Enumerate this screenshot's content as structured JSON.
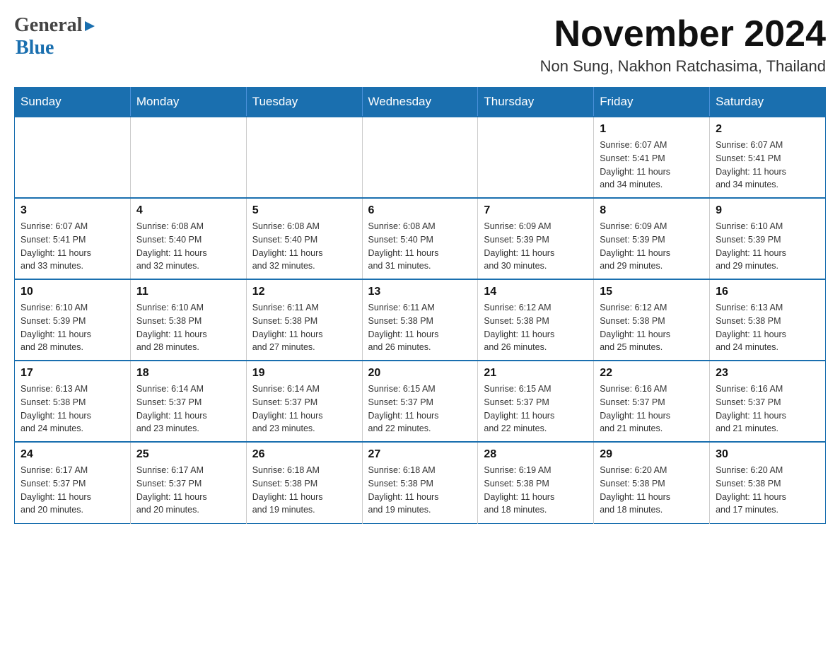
{
  "header": {
    "logo_general": "General",
    "logo_blue": "Blue",
    "month_title": "November 2024",
    "location": "Non Sung, Nakhon Ratchasima, Thailand"
  },
  "days_of_week": [
    "Sunday",
    "Monday",
    "Tuesday",
    "Wednesday",
    "Thursday",
    "Friday",
    "Saturday"
  ],
  "weeks": [
    [
      {
        "day": "",
        "info": ""
      },
      {
        "day": "",
        "info": ""
      },
      {
        "day": "",
        "info": ""
      },
      {
        "day": "",
        "info": ""
      },
      {
        "day": "",
        "info": ""
      },
      {
        "day": "1",
        "info": "Sunrise: 6:07 AM\nSunset: 5:41 PM\nDaylight: 11 hours\nand 34 minutes."
      },
      {
        "day": "2",
        "info": "Sunrise: 6:07 AM\nSunset: 5:41 PM\nDaylight: 11 hours\nand 34 minutes."
      }
    ],
    [
      {
        "day": "3",
        "info": "Sunrise: 6:07 AM\nSunset: 5:41 PM\nDaylight: 11 hours\nand 33 minutes."
      },
      {
        "day": "4",
        "info": "Sunrise: 6:08 AM\nSunset: 5:40 PM\nDaylight: 11 hours\nand 32 minutes."
      },
      {
        "day": "5",
        "info": "Sunrise: 6:08 AM\nSunset: 5:40 PM\nDaylight: 11 hours\nand 32 minutes."
      },
      {
        "day": "6",
        "info": "Sunrise: 6:08 AM\nSunset: 5:40 PM\nDaylight: 11 hours\nand 31 minutes."
      },
      {
        "day": "7",
        "info": "Sunrise: 6:09 AM\nSunset: 5:39 PM\nDaylight: 11 hours\nand 30 minutes."
      },
      {
        "day": "8",
        "info": "Sunrise: 6:09 AM\nSunset: 5:39 PM\nDaylight: 11 hours\nand 29 minutes."
      },
      {
        "day": "9",
        "info": "Sunrise: 6:10 AM\nSunset: 5:39 PM\nDaylight: 11 hours\nand 29 minutes."
      }
    ],
    [
      {
        "day": "10",
        "info": "Sunrise: 6:10 AM\nSunset: 5:39 PM\nDaylight: 11 hours\nand 28 minutes."
      },
      {
        "day": "11",
        "info": "Sunrise: 6:10 AM\nSunset: 5:38 PM\nDaylight: 11 hours\nand 28 minutes."
      },
      {
        "day": "12",
        "info": "Sunrise: 6:11 AM\nSunset: 5:38 PM\nDaylight: 11 hours\nand 27 minutes."
      },
      {
        "day": "13",
        "info": "Sunrise: 6:11 AM\nSunset: 5:38 PM\nDaylight: 11 hours\nand 26 minutes."
      },
      {
        "day": "14",
        "info": "Sunrise: 6:12 AM\nSunset: 5:38 PM\nDaylight: 11 hours\nand 26 minutes."
      },
      {
        "day": "15",
        "info": "Sunrise: 6:12 AM\nSunset: 5:38 PM\nDaylight: 11 hours\nand 25 minutes."
      },
      {
        "day": "16",
        "info": "Sunrise: 6:13 AM\nSunset: 5:38 PM\nDaylight: 11 hours\nand 24 minutes."
      }
    ],
    [
      {
        "day": "17",
        "info": "Sunrise: 6:13 AM\nSunset: 5:38 PM\nDaylight: 11 hours\nand 24 minutes."
      },
      {
        "day": "18",
        "info": "Sunrise: 6:14 AM\nSunset: 5:37 PM\nDaylight: 11 hours\nand 23 minutes."
      },
      {
        "day": "19",
        "info": "Sunrise: 6:14 AM\nSunset: 5:37 PM\nDaylight: 11 hours\nand 23 minutes."
      },
      {
        "day": "20",
        "info": "Sunrise: 6:15 AM\nSunset: 5:37 PM\nDaylight: 11 hours\nand 22 minutes."
      },
      {
        "day": "21",
        "info": "Sunrise: 6:15 AM\nSunset: 5:37 PM\nDaylight: 11 hours\nand 22 minutes."
      },
      {
        "day": "22",
        "info": "Sunrise: 6:16 AM\nSunset: 5:37 PM\nDaylight: 11 hours\nand 21 minutes."
      },
      {
        "day": "23",
        "info": "Sunrise: 6:16 AM\nSunset: 5:37 PM\nDaylight: 11 hours\nand 21 minutes."
      }
    ],
    [
      {
        "day": "24",
        "info": "Sunrise: 6:17 AM\nSunset: 5:37 PM\nDaylight: 11 hours\nand 20 minutes."
      },
      {
        "day": "25",
        "info": "Sunrise: 6:17 AM\nSunset: 5:37 PM\nDaylight: 11 hours\nand 20 minutes."
      },
      {
        "day": "26",
        "info": "Sunrise: 6:18 AM\nSunset: 5:38 PM\nDaylight: 11 hours\nand 19 minutes."
      },
      {
        "day": "27",
        "info": "Sunrise: 6:18 AM\nSunset: 5:38 PM\nDaylight: 11 hours\nand 19 minutes."
      },
      {
        "day": "28",
        "info": "Sunrise: 6:19 AM\nSunset: 5:38 PM\nDaylight: 11 hours\nand 18 minutes."
      },
      {
        "day": "29",
        "info": "Sunrise: 6:20 AM\nSunset: 5:38 PM\nDaylight: 11 hours\nand 18 minutes."
      },
      {
        "day": "30",
        "info": "Sunrise: 6:20 AM\nSunset: 5:38 PM\nDaylight: 11 hours\nand 17 minutes."
      }
    ]
  ]
}
